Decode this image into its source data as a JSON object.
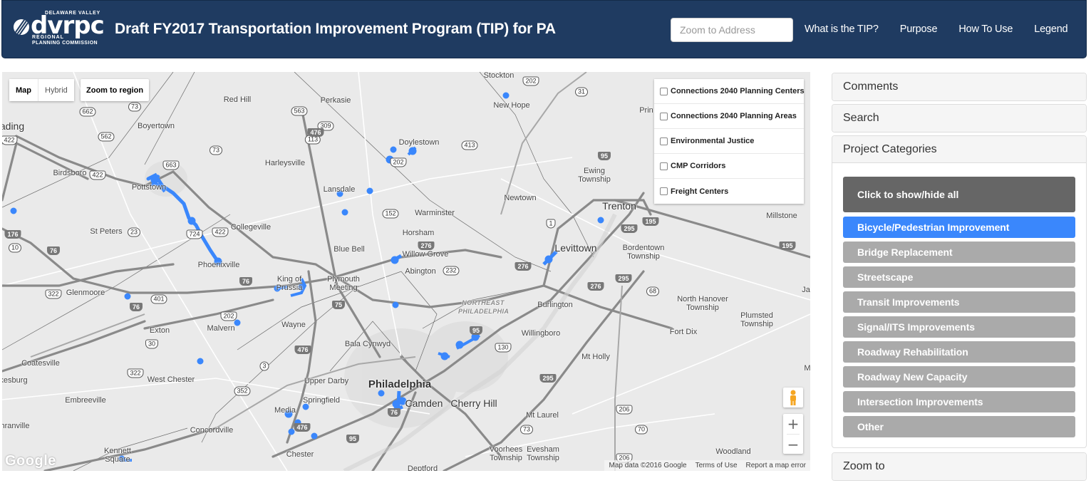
{
  "header": {
    "logo": {
      "top_text": "DELAWARE VALLEY",
      "word": "dvrpc",
      "sub1": "REGIONAL",
      "sub2": "PLANNING COMMISSION"
    },
    "title": "Draft FY2017 Transportation Improvement Program (TIP) for PA",
    "address_placeholder": "Zoom to Address",
    "nav": [
      "What is the TIP?",
      "Purpose",
      "How To Use",
      "Legend"
    ]
  },
  "map": {
    "type_controls": {
      "map": "Map",
      "hybrid": "Hybrid",
      "active": "Map"
    },
    "zoom_region_label": "Zoom to region",
    "layers": [
      {
        "label": "Connections 2040 Planning Centers",
        "checked": false
      },
      {
        "label": "Connections 2040 Planning Areas",
        "checked": false
      },
      {
        "label": "Environmental Justice",
        "checked": false
      },
      {
        "label": "CMP Corridors",
        "checked": false
      },
      {
        "label": "Freight Centers",
        "checked": false
      }
    ],
    "zoom_in": "+",
    "zoom_out": "−",
    "google_logo": "Google",
    "attribution": [
      "Map data ©2016 Google",
      "Terms of Use",
      "Report a map error"
    ],
    "marker_color": "#3a87fc",
    "places": {
      "stockton": "Stockton",
      "red_hill": "Red Hill",
      "perkasie": "Perkasie",
      "new_hope": "New Hope",
      "prin": "Prin",
      "reading": "ading",
      "boyertown": "Boyertown",
      "doylestown": "Doylestown",
      "harleysville": "Harleysville",
      "birdsboro": "Birdsboro",
      "pottstown": "Pottstown",
      "lansdale": "Lansdale",
      "ewing": "Ewing Township",
      "newtown": "Newtown",
      "trenton": "Trenton",
      "warminster": "Warminster",
      "millstone": "Millstone",
      "st_peters": "St Peters",
      "collegeville": "Collegeville",
      "horsham": "Horsham",
      "levittown": "Levittown",
      "blue_bell": "Blue Bell",
      "willow_grove": "Willow Grove",
      "bordentown": "Bordentown Township",
      "phoenixville": "Phoenixville",
      "abington": "Abington",
      "king_of_prussia": "King of Prussia",
      "plymouth": "Plymouth Meeting",
      "glenmoore": "Glenmoore",
      "north_hanover": "North Hanover Township",
      "ne_philly": "NORTHEAST PHILADELPHIA",
      "burlington": "Burlington",
      "plumsted": "Plumsted Township",
      "exton": "Exton",
      "malvern": "Malvern",
      "wayne": "Wayne",
      "willingboro": "Willingboro",
      "fort_dix": "Fort Dix",
      "bala": "Bala Cynwyd",
      "coatesville": "Coatesville",
      "mt_holly": "Mt Holly",
      "kesburg": "kesburg",
      "west_chester": "West Chester",
      "upper_darby": "Upper Darby",
      "philadelphia": "Philadelphia",
      "embreeville": "Embreeville",
      "springfield": "Springfield",
      "camden": "Camden",
      "cherry_hill": "Cherry Hill",
      "mt_laurel": "Mt Laurel",
      "media": "Media",
      "hranville": "hranville",
      "concordville": "Concordville",
      "woodland": "Woodland",
      "voorhees": "Voorhees Township",
      "evesham": "Evesham Township",
      "kennett": "Kennett Square",
      "chester": "Chester",
      "deptford": "Deptford",
      "ja": "Ja",
      "m": "M"
    }
  },
  "sidebar": {
    "comments": "Comments",
    "search": "Search",
    "categories_title": "Project Categories",
    "show_hide_all": "Click to show/hide all",
    "categories": [
      {
        "label": "Bicycle/Pedestrian Improvement",
        "active": true
      },
      {
        "label": "Bridge Replacement",
        "active": false
      },
      {
        "label": "Streetscape",
        "active": false
      },
      {
        "label": "Transit Improvements",
        "active": false
      },
      {
        "label": "Signal/ITS Improvements",
        "active": false
      },
      {
        "label": "Roadway Rehabilitation",
        "active": false
      },
      {
        "label": "Roadway New Capacity",
        "active": false
      },
      {
        "label": "Intersection Improvements",
        "active": false
      },
      {
        "label": "Other",
        "active": false
      }
    ],
    "zoom_to": "Zoom to",
    "colors": {
      "active": "#3a87fc",
      "inactive": "#aaaaaa",
      "all": "#666666"
    }
  }
}
